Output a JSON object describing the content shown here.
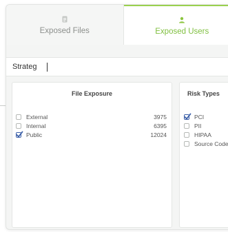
{
  "tabs": [
    {
      "label": "Exposed Files",
      "icon": "file-icon",
      "active": false
    },
    {
      "label": "Exposed Users",
      "icon": "user-icon",
      "active": true
    }
  ],
  "search": {
    "value": "Strateg",
    "placeholder": ""
  },
  "file_exposure": {
    "title": "File Exposure",
    "items": [
      {
        "label": "External",
        "count": "3975",
        "checked": false
      },
      {
        "label": "Internal",
        "count": "6395",
        "checked": false
      },
      {
        "label": "Public",
        "count": "12024",
        "checked": true
      }
    ]
  },
  "risk_types": {
    "title": "Risk Types",
    "items": [
      {
        "label": "PCI",
        "checked": true
      },
      {
        "label": "PII",
        "checked": false
      },
      {
        "label": "HIPAA",
        "checked": false
      },
      {
        "label": "Source Code",
        "checked": false
      }
    ]
  },
  "colors": {
    "accent": "#7fbf3f",
    "checkbox_checked": "#3b5fa8"
  }
}
